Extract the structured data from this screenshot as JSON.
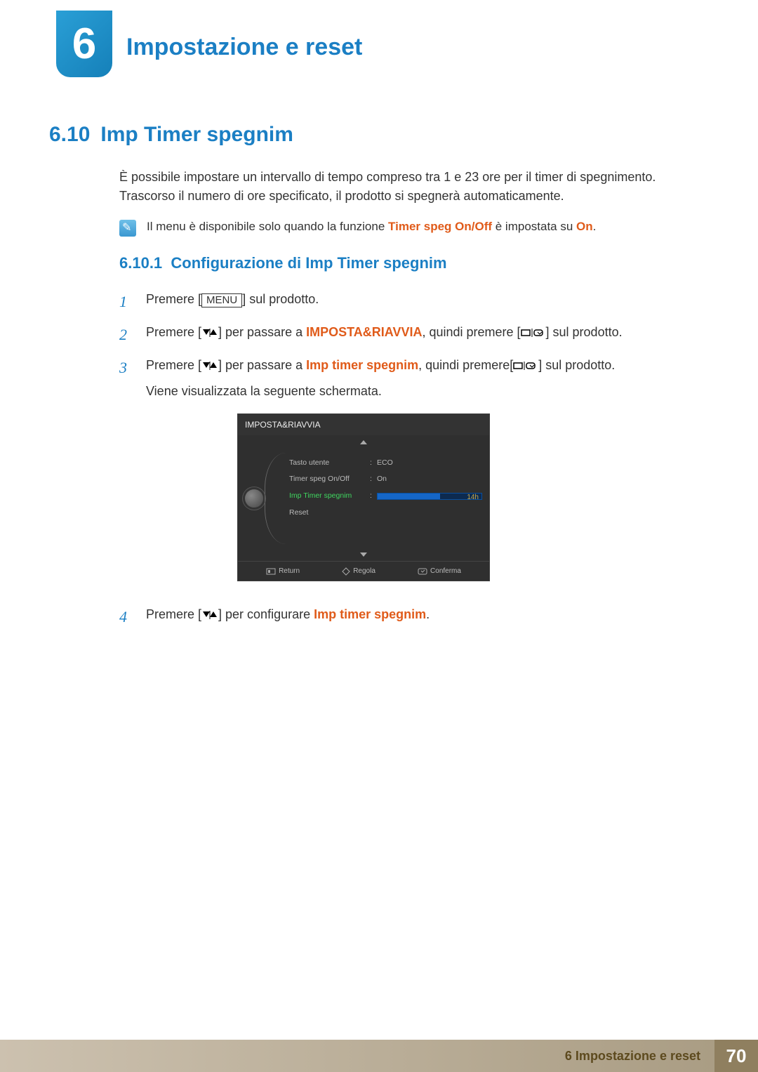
{
  "chapter": {
    "number": "6",
    "title": "Impostazione e reset"
  },
  "section": {
    "number": "6.10",
    "title": "Imp Timer spegnim"
  },
  "intro": "È possibile impostare un intervallo di tempo compreso tra 1 e 23 ore per il timer di spegnimento. Trascorso il numero di ore specificato, il prodotto si spegnerà automaticamente.",
  "note": {
    "before": "Il menu è disponibile solo quando la funzione ",
    "bold1": "Timer speg On/Off",
    "mid": " è impostata su ",
    "bold2": "On",
    "after": "."
  },
  "subsection": {
    "number": "6.10.1",
    "title": "Configurazione di Imp Timer spegnim"
  },
  "buttons": {
    "menu": "MENU"
  },
  "step1": {
    "a": "Premere [",
    "b": "] sul prodotto."
  },
  "step2": {
    "a": "Premere [",
    "b": "] per passare a ",
    "hl": "IMPOSTA&RIAVVIA",
    "c": ", quindi premere [",
    "d": "] sul prodotto."
  },
  "step3": {
    "a": "Premere [",
    "b": "] per passare a ",
    "hl": "Imp timer spegnim",
    "c": ", quindi premere[",
    "d": "] sul prodotto.",
    "e": "Viene visualizzata la seguente schermata."
  },
  "step4": {
    "a": "Premere [",
    "b": "] per configurare ",
    "hl": "Imp timer spegnim",
    "c": "."
  },
  "osd": {
    "title": "IMPOSTA&RIAVVIA",
    "rows": [
      {
        "label": "Tasto utente",
        "value": "ECO"
      },
      {
        "label": "Timer speg On/Off",
        "value": "On"
      },
      {
        "label": "Imp Timer spegnim",
        "value": "14h",
        "active": true
      },
      {
        "label": "Reset",
        "value": ""
      }
    ],
    "footer": {
      "return": "Return",
      "adjust": "Regola",
      "confirm": "Conferma"
    }
  },
  "footer": {
    "text": "6 Impostazione e reset",
    "page": "70"
  }
}
